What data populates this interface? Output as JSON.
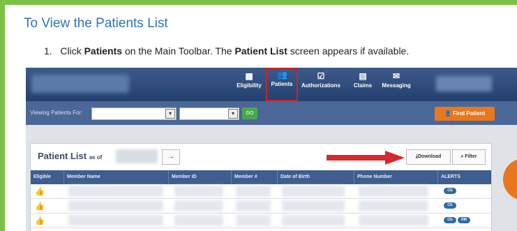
{
  "doc": {
    "heading": "To View the Patients List",
    "step_number": "1.",
    "step_parts": [
      "Click ",
      "Patients",
      " on the Main Toolbar. The ",
      "Patient List",
      " screen appears if available."
    ]
  },
  "screenshot": {
    "nav": [
      {
        "label": "Eligibility",
        "icon": "calendar-icon"
      },
      {
        "label": "Patients",
        "icon": "patients-icon",
        "active": true
      },
      {
        "label": "Authorizations",
        "icon": "authorization-icon"
      },
      {
        "label": "Claims",
        "icon": "claims-icon"
      },
      {
        "label": "Messaging",
        "icon": "envelope-icon"
      }
    ],
    "filter_label": "Viewing Patients For:",
    "go_label": "GO",
    "find_patient": "Find Patient",
    "panel": {
      "title": "Patient List",
      "as_of": "as of",
      "download": "Download",
      "filter": "Filter"
    },
    "columns": [
      "Eligible",
      "Member Name",
      "Member ID",
      "Member #",
      "Date of Birth",
      "Phone Number",
      "ALERTS"
    ],
    "rows": [
      {
        "alerts": [
          "CG"
        ]
      },
      {
        "alerts": [
          "CG"
        ]
      },
      {
        "alerts": [
          "CG",
          "DM"
        ]
      }
    ],
    "colors": {
      "accent": "#e8771e",
      "header": "#3f5d8f",
      "highlight": "#c8242b",
      "border": "#7cc242"
    }
  }
}
